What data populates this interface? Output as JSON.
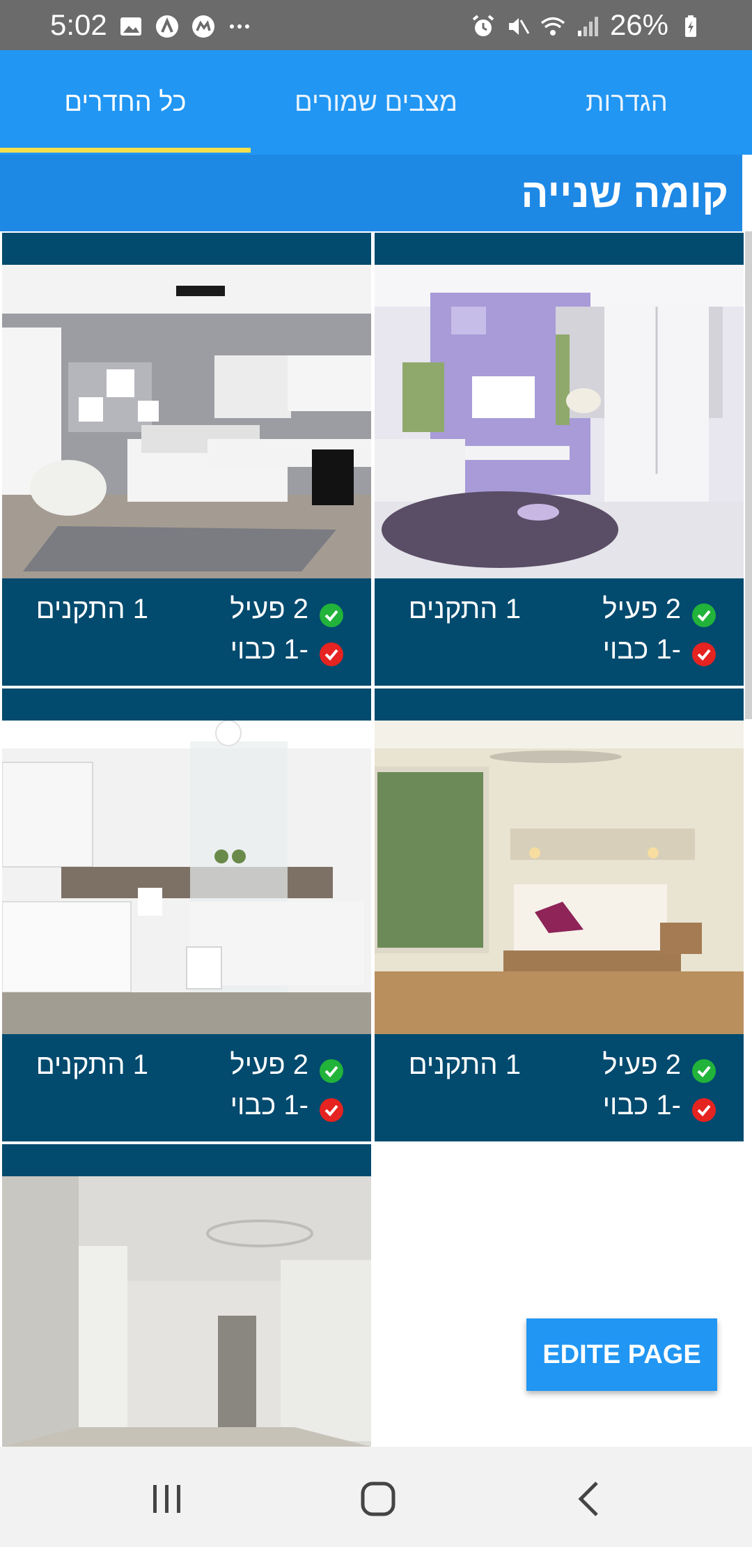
{
  "status_bar": {
    "time": "5:02",
    "battery": "26%",
    "icons": [
      "image-icon",
      "app-icon",
      "messenger-icon",
      "more-icon",
      "alarm-icon",
      "mute-icon",
      "wifi-icon",
      "signal-icon",
      "battery-icon"
    ]
  },
  "tabs": [
    {
      "label": "כל החדרים",
      "active": true
    },
    {
      "label": "מצבים שמורים",
      "active": false
    },
    {
      "label": "הגדרות",
      "active": false
    }
  ],
  "floor": {
    "title": "קומה שנייה"
  },
  "rooms": [
    {
      "image": "kids-bedroom-lavender",
      "active": "2 פעיל",
      "off": "-1 כבוי",
      "devices": "1 התקנים"
    },
    {
      "image": "kids-bedroom-gray",
      "active": "2 פעיל",
      "off": "-1 כבוי",
      "devices": "1 התקנים"
    },
    {
      "image": "master-bedroom",
      "active": "2 פעיל",
      "off": "-1 כבוי",
      "devices": "1 התקנים"
    },
    {
      "image": "bathroom",
      "active": "2 פעיל",
      "off": "-1 כבוי",
      "devices": "1 התקנים"
    },
    {
      "image": "empty-room"
    }
  ],
  "edit_button": {
    "label": "EDITE PAGE"
  },
  "colors": {
    "primary": "#2196f3",
    "floor_header": "#1e88e5",
    "card": "#024a6e",
    "indicator": "#f4e04d",
    "ok": "#22b33a",
    "off": "#e52320"
  }
}
